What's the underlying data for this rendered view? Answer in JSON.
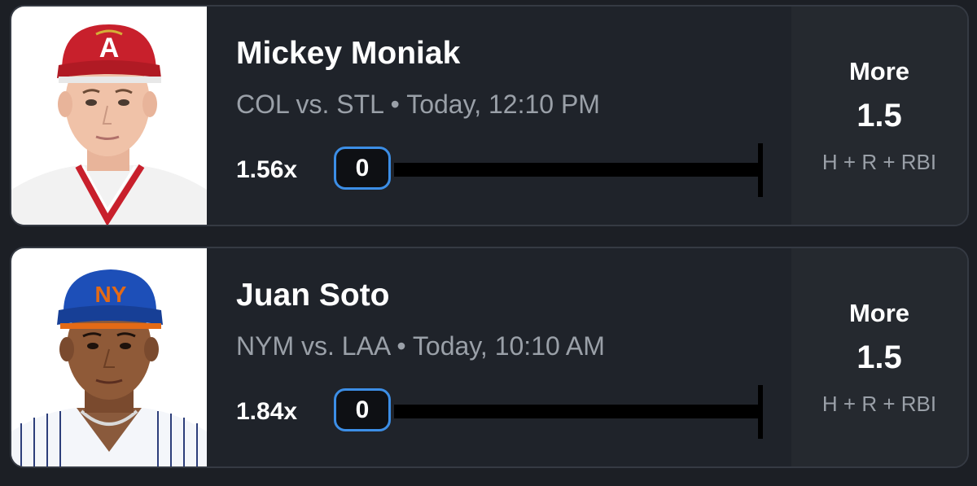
{
  "cards": [
    {
      "player_name": "Mickey Moniak",
      "game_info": "COL vs. STL • Today, 12:10 PM",
      "multiplier": "1.56x",
      "progress_value": "0",
      "pick_direction": "More",
      "pick_line": "1.5",
      "pick_stat": "H + R + RBI",
      "cap_color": "#c8202c",
      "cap_logo": "A"
    },
    {
      "player_name": "Juan Soto",
      "game_info": "NYM vs. LAA • Today, 10:10 AM",
      "multiplier": "1.84x",
      "progress_value": "0",
      "pick_direction": "More",
      "pick_line": "1.5",
      "pick_stat": "H + R + RBI",
      "cap_color": "#1d4fb8",
      "cap_logo": "NY"
    }
  ],
  "colors": {
    "background": "#1c1f25",
    "card": "#1f232a",
    "card_border": "#353a43",
    "accent_blue": "#3c8ee6",
    "muted_text": "#9aa0a8"
  }
}
